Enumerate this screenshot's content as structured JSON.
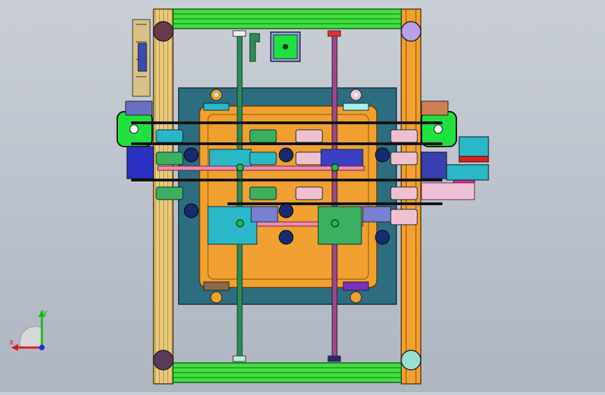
{
  "viewport": {
    "title": "",
    "background": [
      "#c9ced6",
      "#aeb6c1"
    ],
    "colors": {
      "frame_wood": "#e8c97a",
      "frame_orange": "#f4a030",
      "green_bar": "#3ee03e",
      "plate_teal": "#2c6e80",
      "plate_orange": "#f0a030",
      "rod_green": "#2f8a5a",
      "rod_purple": "#9a4a8a",
      "motor_green": "#20e040",
      "bearing_cyan": "#2ab8c8",
      "belt_black": "#111111",
      "carriage_blue": "#2a30c0",
      "pink_rod": "#f08ab0"
    }
  },
  "triad": {
    "x_label": "X",
    "y_label": "Y",
    "x_color": "#e01818",
    "y_color": "#18b818",
    "z_color": "#2030e0"
  }
}
